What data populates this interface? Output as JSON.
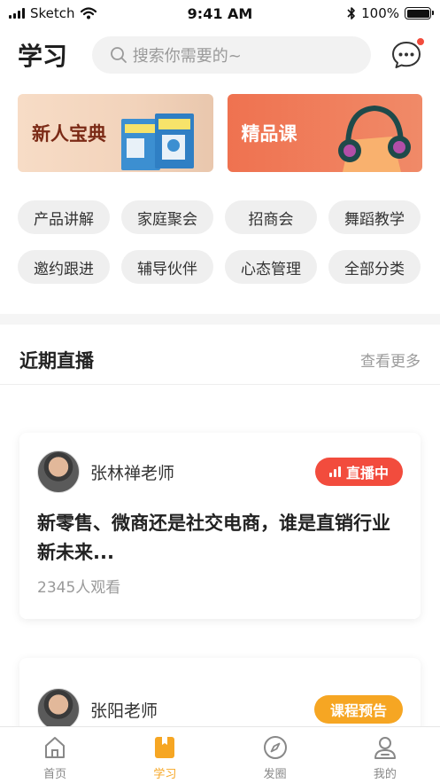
{
  "status_bar": {
    "carrier": "Sketch",
    "time": "9:41 AM",
    "battery": "100%"
  },
  "header": {
    "title": "学习",
    "search_placeholder": "搜索你需要的~",
    "message_icon": "chat-bubble-icon",
    "has_unread": true
  },
  "banners": [
    {
      "label": "新人宝典",
      "icon": "book-icon"
    },
    {
      "label": "精品课",
      "icon": "headphones-icon"
    }
  ],
  "categories": [
    "产品讲解",
    "家庭聚会",
    "招商会",
    "舞蹈教学",
    "邀约跟进",
    "辅导伙伴",
    "心态管理",
    "全部分类"
  ],
  "section": {
    "title": "近期直播",
    "more": "查看更多"
  },
  "live_items": [
    {
      "teacher": "张林禅老师",
      "badge": "直播中",
      "title": "新零售、微商还是社交电商，谁是直销行业新未来...",
      "viewers": "2345人观看"
    },
    {
      "teacher": "张阳老师",
      "badge": "课程预告"
    }
  ],
  "tabbar": {
    "tabs": [
      {
        "label": "首页",
        "icon": "home-icon"
      },
      {
        "label": "学习",
        "icon": "bookmark-book-icon",
        "active": true
      },
      {
        "label": "发圈",
        "icon": "compass-icon"
      },
      {
        "label": "我的",
        "icon": "profile-icon"
      }
    ]
  },
  "colors": {
    "accent": "#F6A623",
    "live_red": "#F24C3D",
    "banner_orange": "#EF7250",
    "banner_peach": "#F2D3BB"
  }
}
